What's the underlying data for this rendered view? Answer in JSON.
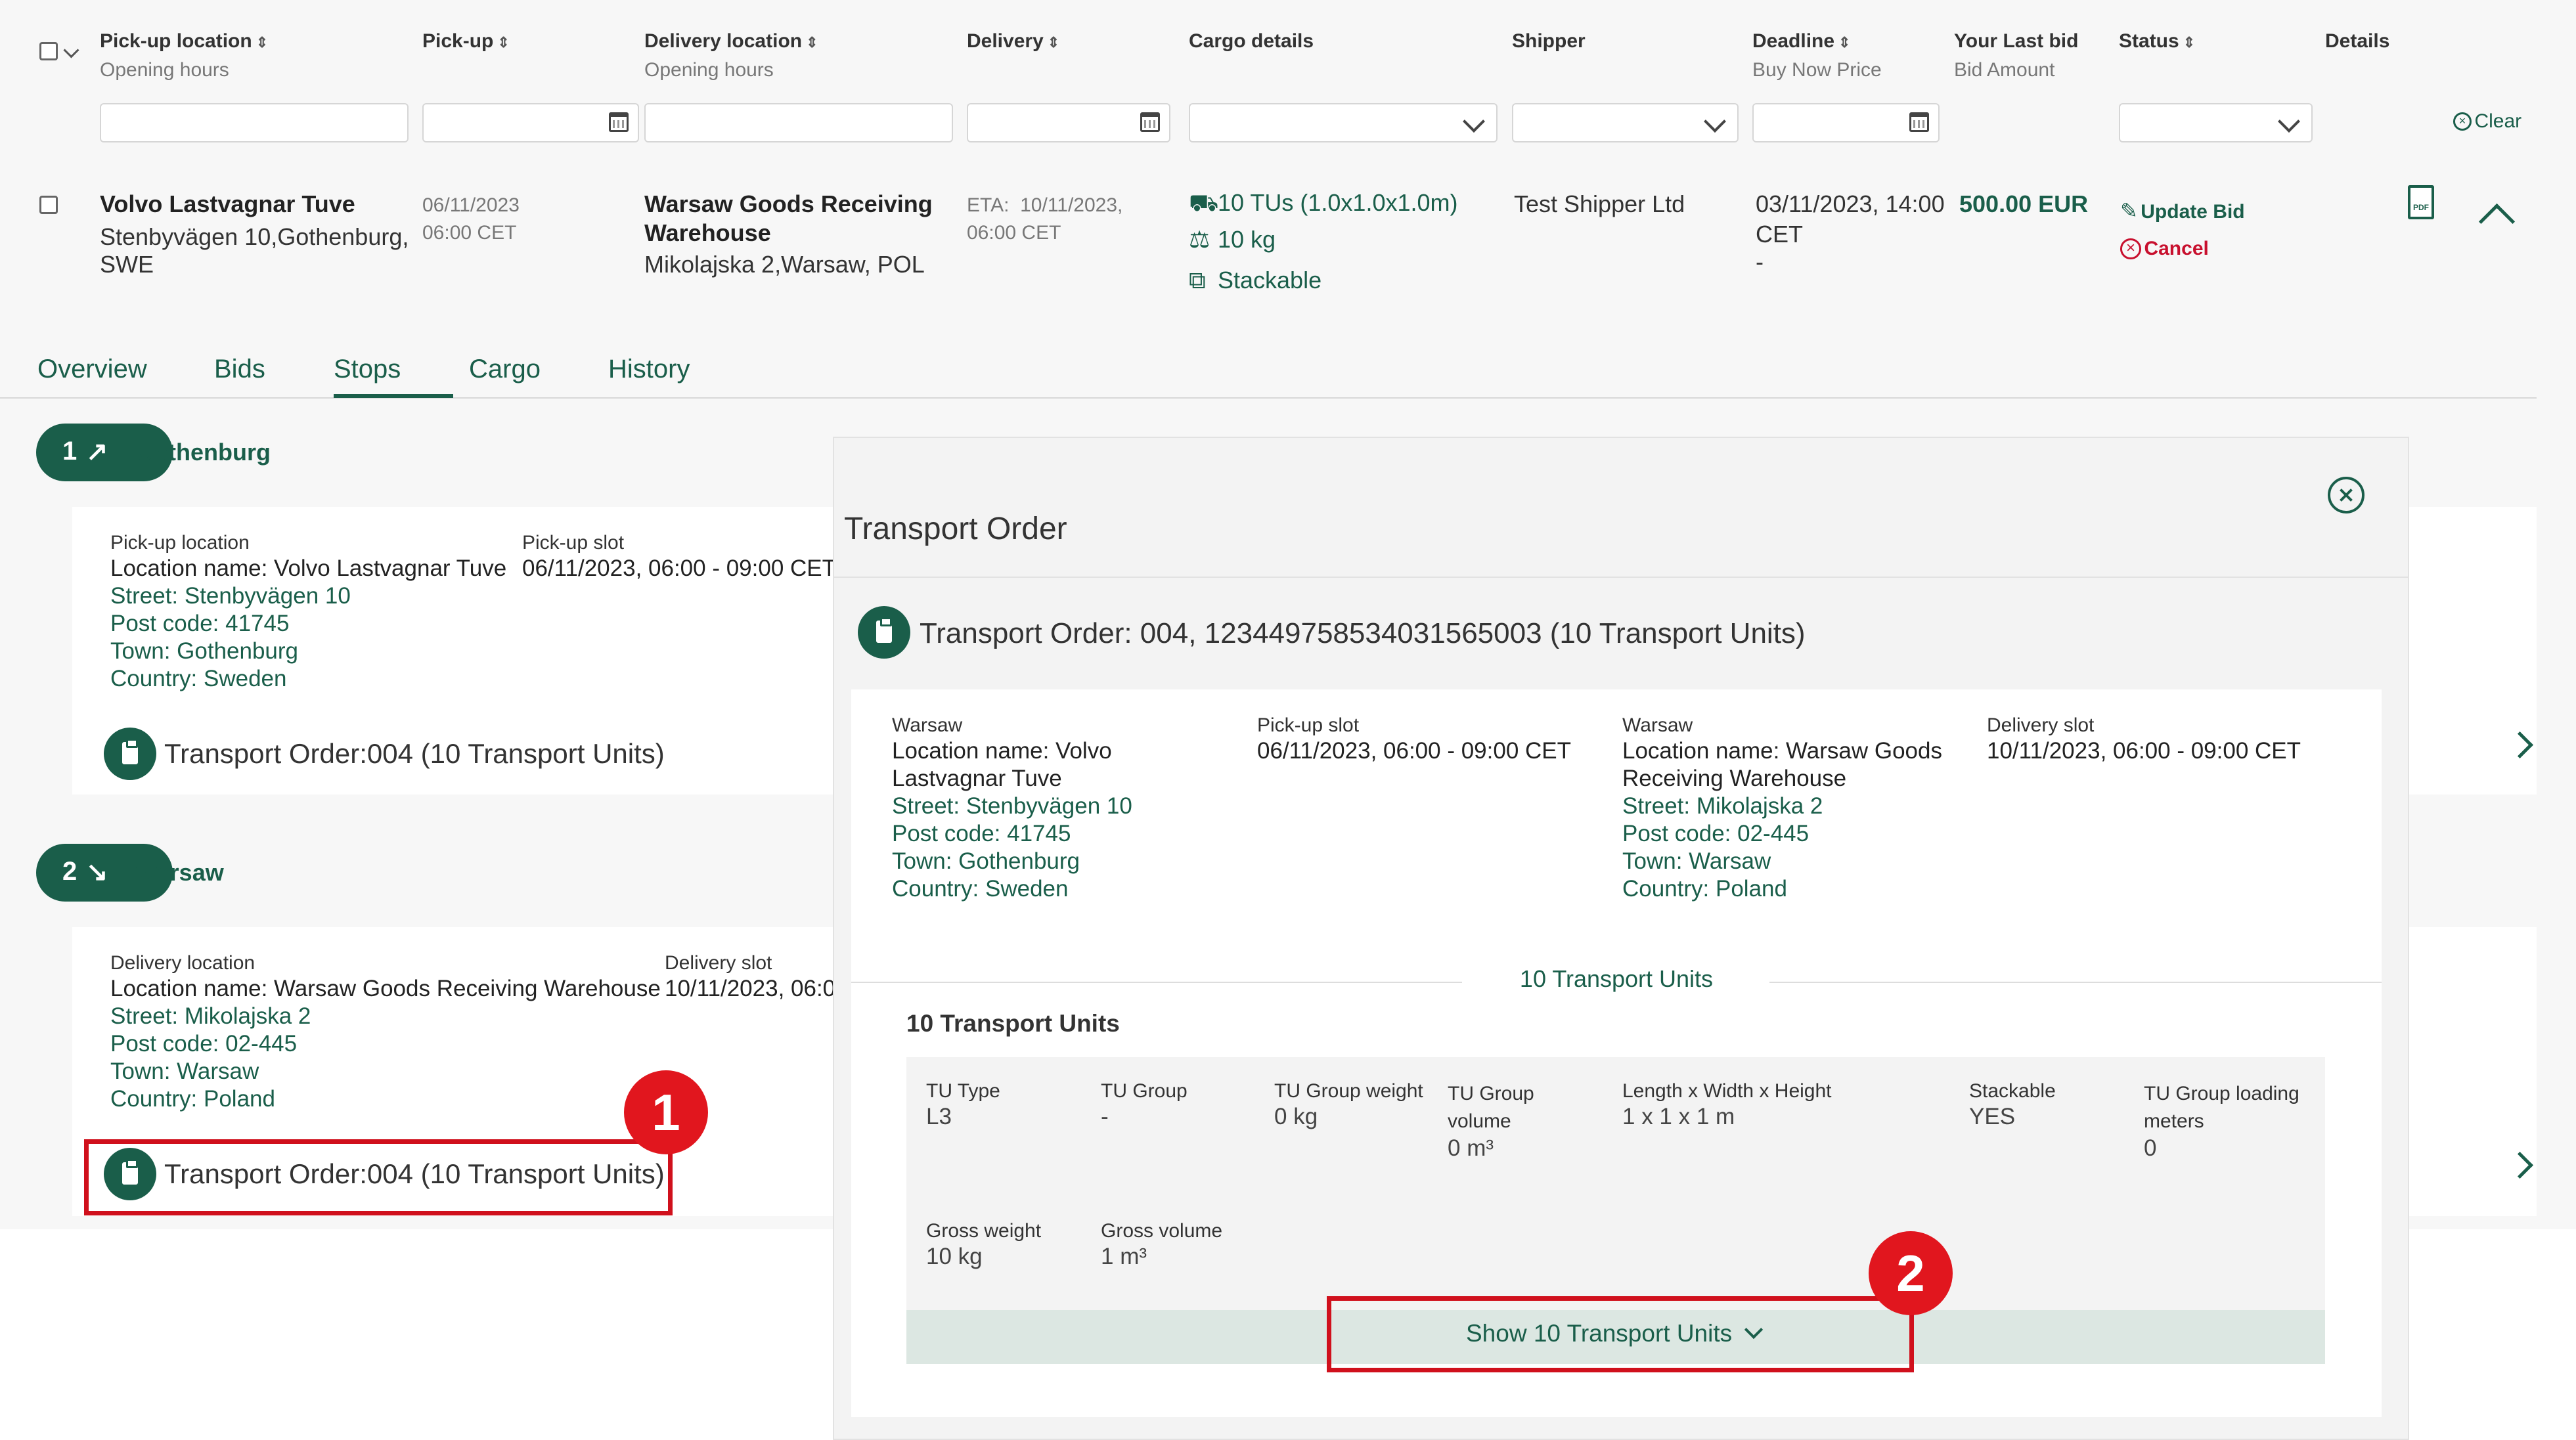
{
  "header": {
    "columns": [
      {
        "title": "Pick-up location",
        "sub": "Opening hours",
        "sortable": true
      },
      {
        "title": "Pick-up",
        "sub": "",
        "sortable": true
      },
      {
        "title": "Delivery location",
        "sub": "Opening hours",
        "sortable": true
      },
      {
        "title": "Delivery",
        "sub": "",
        "sortable": true
      },
      {
        "title": "Cargo details",
        "sub": "",
        "sortable": false
      },
      {
        "title": "Shipper",
        "sub": "",
        "sortable": false
      },
      {
        "title": "Deadline",
        "sub": "Buy Now Price",
        "sortable": true
      },
      {
        "title": "Your Last bid",
        "sub": "Bid Amount",
        "sortable": false
      },
      {
        "title": "Status",
        "sub": "",
        "sortable": true
      },
      {
        "title": "Details",
        "sub": "",
        "sortable": false
      }
    ],
    "sort_glyph": "⇕",
    "clear_label": "Clear"
  },
  "row": {
    "pickup_name": "Volvo Lastvagnar Tuve",
    "pickup_address_1": "Stenbyvägen 10,Gothenburg,",
    "pickup_address_2": "SWE",
    "pickup_date": "06/11/2023",
    "pickup_time": "06:00 CET",
    "delivery_name_1": "Warsaw Goods Receiving",
    "delivery_name_2": "Warehouse",
    "delivery_address": "Mikolajska 2,Warsaw, POL",
    "eta_label": "ETA:",
    "eta_date": "10/11/2023,",
    "eta_time": "06:00 CET",
    "cargo_tus": "10 TUs (1.0x1.0x1.0m)",
    "cargo_weight": "10 kg",
    "cargo_stackable": "Stackable",
    "shipper": "Test Shipper Ltd",
    "deadline_1": "03/11/2023, 14:00",
    "deadline_2": "CET",
    "deadline_3": "-",
    "bid_amount": "500.00 EUR",
    "update_bid": "Update Bid",
    "cancel": "Cancel"
  },
  "tabs": [
    "Overview",
    "Bids",
    "Stops",
    "Cargo",
    "History"
  ],
  "active_tab": "Stops",
  "stops": [
    {
      "number": "1",
      "name": "Gothenburg",
      "type_label": "Pick-up location",
      "location_name": "Location name: Volvo Lastvagnar Tuve",
      "street": "Street: Stenbyvägen 10",
      "post_code": "Post code: 41745",
      "town": "Town: Gothenburg",
      "country": "Country: Sweden",
      "slot_label": "Pick-up slot",
      "slot_value": "06/11/2023, 06:00 - 09:00 CET",
      "transport_order": "Transport Order:004 (10 Transport Units)"
    },
    {
      "number": "2",
      "name": "Warsaw",
      "type_label": "Delivery location",
      "location_name": "Location name: Warsaw Goods Receiving Warehouse",
      "street": "Street: Mikolajska 2",
      "post_code": "Post code: 02-445",
      "town": "Town: Warsaw",
      "country": "Country: Poland",
      "slot_label": "Delivery slot",
      "slot_value": "10/11/2023, 06:0",
      "transport_order": "Transport Order:004 (10 Transport Units)"
    }
  ],
  "modal": {
    "title": "Transport Order",
    "order_heading": "Transport Order: 004, 123449758534031565003  (10 Transport Units)",
    "pickup": {
      "city": "Warsaw",
      "name_1": "Location name: Volvo",
      "name_2": "Lastvagnar Tuve",
      "street": "Street: Stenbyvägen 10",
      "post_code": "Post code: 41745",
      "town": "Town: Gothenburg",
      "country": "Country: Sweden",
      "slot_label": "Pick-up slot",
      "slot_value": "06/11/2023, 06:00 - 09:00 CET"
    },
    "delivery": {
      "city": "Warsaw",
      "name_1": "Location name: Warsaw Goods",
      "name_2": "Receiving Warehouse",
      "street": "Street: Mikolajska 2",
      "post_code": "Post code: 02-445",
      "town": "Town: Warsaw",
      "country": "Country: Poland",
      "slot_label": "Delivery slot",
      "slot_value": "10/11/2023, 06:00 - 09:00 CET"
    },
    "tu_divider": "10 Transport Units",
    "tu_heading": "10 Transport Units",
    "tu_fields": [
      {
        "label": "TU Type",
        "value": "L3"
      },
      {
        "label": "TU Group",
        "value": "-"
      },
      {
        "label": "TU Group weight",
        "value": "0 kg"
      },
      {
        "label": "TU Group volume",
        "value": "0 m³"
      },
      {
        "label": "Length x Width x Height",
        "value": "1 x 1 x 1 m"
      },
      {
        "label": "Stackable",
        "value": "YES"
      },
      {
        "label": "TU Group loading meters",
        "value": "0"
      },
      {
        "label": "Gross weight",
        "value": "10 kg"
      },
      {
        "label": "Gross volume",
        "value": "1 m³"
      }
    ],
    "show_units": "Show 10 Transport Units"
  },
  "annotations": [
    "1",
    "2"
  ],
  "colors": {
    "brand": "#1a5e4a",
    "danger": "#c8102e",
    "annotation": "#e1161e"
  }
}
